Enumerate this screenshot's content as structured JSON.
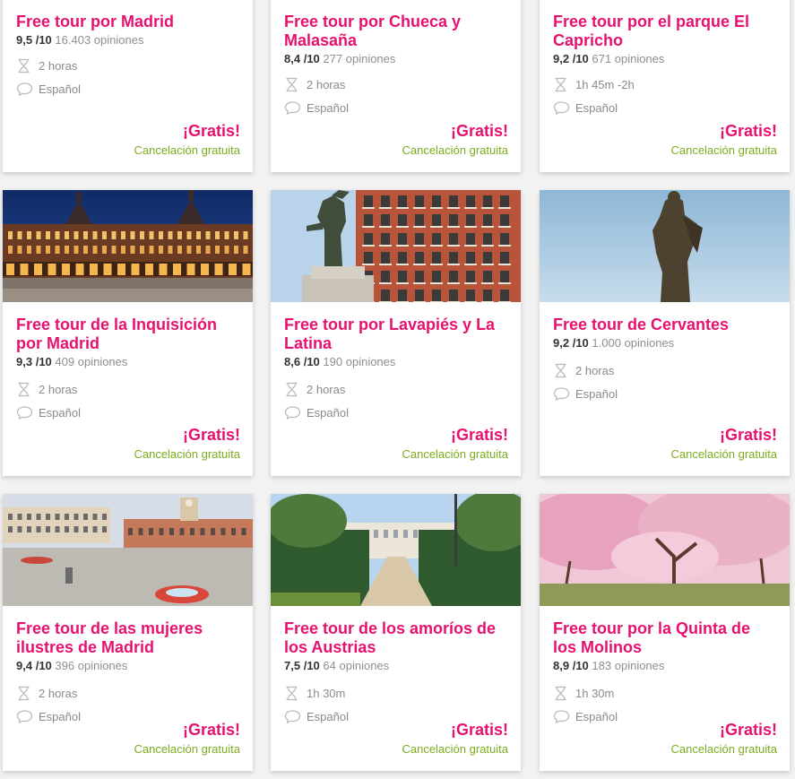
{
  "labels": {
    "per_ten": "/10",
    "reviews_suffix": "opiniones"
  },
  "colors": {
    "title": "#e5126f",
    "price": "#e5126f",
    "cancellation": "#7dac1f",
    "muted": "#8b8b8b"
  },
  "tours": [
    {
      "title_lines": [
        "Free tour por Madrid"
      ],
      "score": "9,5",
      "reviews": "16.403",
      "duration": "2 horas",
      "language": "Español",
      "price": "¡Gratis!",
      "cancellation": "Cancelación gratuita",
      "image": "none"
    },
    {
      "title_lines": [
        "Free tour por Chueca y",
        "Malasaña"
      ],
      "score": "8,4",
      "reviews": "277",
      "duration": "2 horas",
      "language": "Español",
      "price": "¡Gratis!",
      "cancellation": "Cancelación gratuita",
      "image": "none"
    },
    {
      "title_lines": [
        "Free tour por el parque El",
        "Capricho"
      ],
      "score": "9,2",
      "reviews": "671",
      "duration": "1h 45m -2h",
      "language": "Español",
      "price": "¡Gratis!",
      "cancellation": "Cancelación gratuita",
      "image": "none"
    },
    {
      "title_lines": [
        "Free tour de la Inquisición",
        "por Madrid"
      ],
      "score": "9,3",
      "reviews": "409",
      "duration": "2 horas",
      "language": "Español",
      "price": "¡Gratis!",
      "cancellation": "Cancelación gratuita",
      "image": "plaza-mayor-photo"
    },
    {
      "title_lines": [
        "Free tour por Lavapiés y La",
        "Latina"
      ],
      "score": "8,6",
      "reviews": "190",
      "duration": "2 horas",
      "language": "Español",
      "price": "¡Gratis!",
      "cancellation": "Cancelación gratuita",
      "image": "statue-building-photo"
    },
    {
      "title_lines": [
        "Free tour de Cervantes"
      ],
      "score": "9,2",
      "reviews": "1.000",
      "duration": "2 horas",
      "language": "Español",
      "price": "¡Gratis!",
      "cancellation": "Cancelación gratuita",
      "image": "cervantes-statue-photo"
    },
    {
      "title_lines": [
        "Free tour de las mujeres",
        "ilustres de Madrid"
      ],
      "score": "9,4",
      "reviews": "396",
      "duration": "2 horas",
      "language": "Español",
      "price": "¡Gratis!",
      "cancellation": "Cancelación gratuita",
      "image": "puerta-del-sol-photo"
    },
    {
      "title_lines": [
        "Free tour de los amoríos de",
        "los Austrias"
      ],
      "score": "7,5",
      "reviews": "64",
      "duration": "1h 30m",
      "language": "Español",
      "price": "¡Gratis!",
      "cancellation": "Cancelación gratuita",
      "image": "royal-palace-garden-photo"
    },
    {
      "title_lines": [
        "Free tour por la Quinta de",
        "los Molinos"
      ],
      "score": "8,9",
      "reviews": "183",
      "duration": "1h 30m",
      "language": "Español",
      "price": "¡Gratis!",
      "cancellation": "Cancelación gratuita",
      "image": "almond-blossom-photo"
    }
  ]
}
